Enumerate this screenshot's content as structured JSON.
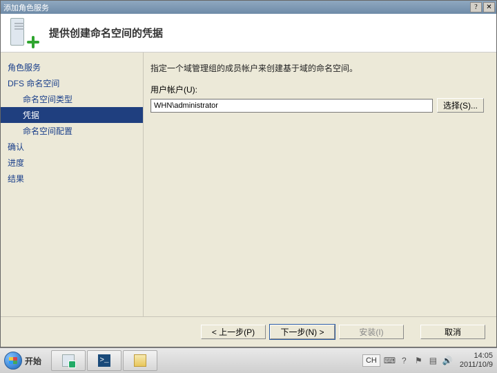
{
  "window": {
    "title": "添加角色服务",
    "close_label": "✕",
    "help_label": "?"
  },
  "header": {
    "title": "提供创建命名空间的凭据"
  },
  "sidebar": {
    "items": [
      {
        "label": "角色服务",
        "level": "top"
      },
      {
        "label": "DFS 命名空间",
        "level": "top"
      },
      {
        "label": "命名空间类型",
        "level": "sub"
      },
      {
        "label": "凭据",
        "level": "sub",
        "selected": true
      },
      {
        "label": "命名空间配置",
        "level": "sub"
      },
      {
        "label": "确认",
        "level": "top"
      },
      {
        "label": "进度",
        "level": "top"
      },
      {
        "label": "结果",
        "level": "top"
      }
    ]
  },
  "content": {
    "description": "指定一个域管理组的成员帐户来创建基于域的命名空间。",
    "account_label": "用户帐户(U):",
    "account_value": "WHN\\administrator",
    "select_button": "选择(S)..."
  },
  "footer": {
    "prev": "< 上一步(P)",
    "next": "下一步(N) >",
    "install": "安装(I)",
    "cancel": "取消"
  },
  "taskbar": {
    "start": "开始",
    "lang": "CH",
    "time": "14:05",
    "date": "2011/10/9"
  }
}
